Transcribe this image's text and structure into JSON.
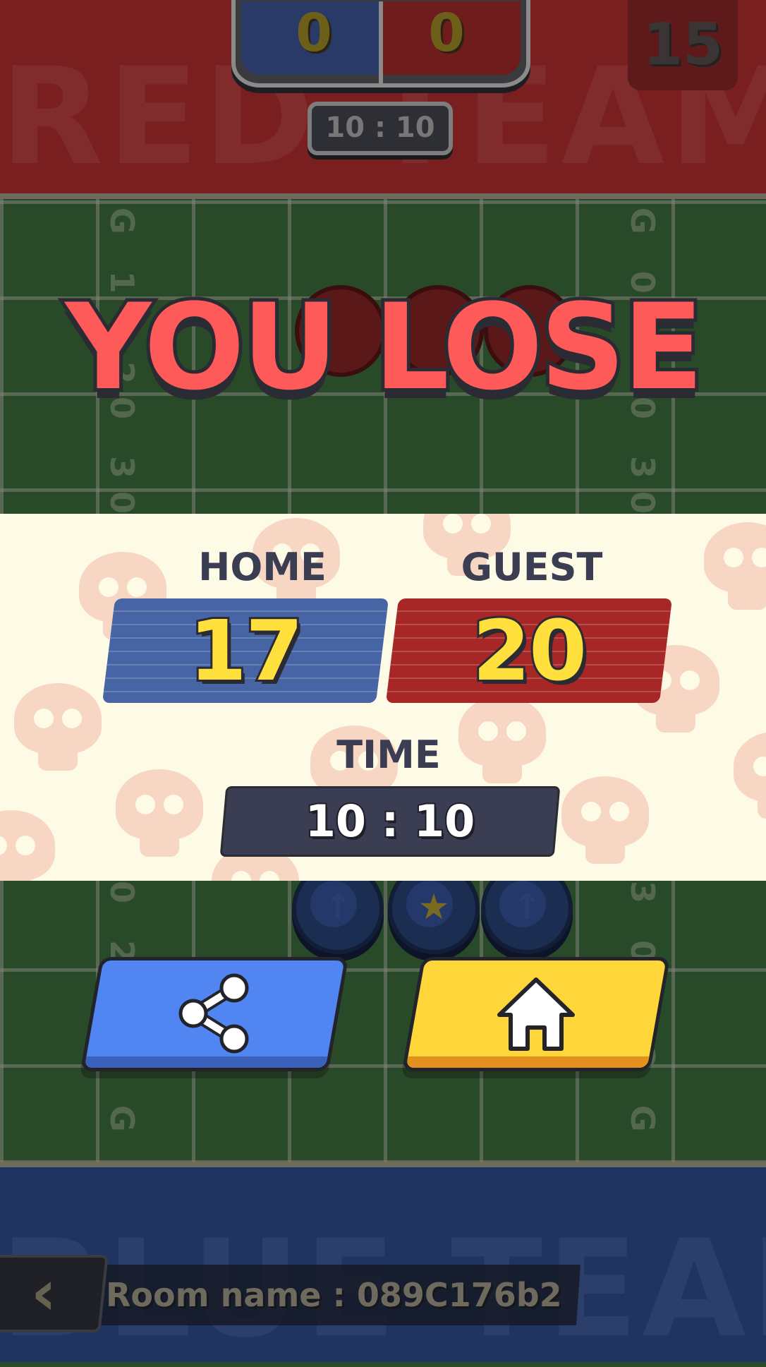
{
  "top_bar": {
    "background_text": "RED TEAM",
    "scoreboard": {
      "blue_score": "0",
      "red_score": "0"
    },
    "match_timer": "10 : 10",
    "round_number": "15"
  },
  "field": {
    "yard_left_top": "G 1",
    "yard_left_mid": "20 30",
    "yard_right_top": "G 0",
    "yard_right_mid": "20 30",
    "yard_left_bottom": "0 2",
    "yard_right_bottom": "3 0",
    "yard_left_end": "0 G",
    "yard_right_end": "2 G"
  },
  "result": {
    "title": "YOU LOSE",
    "home_label": "HOME",
    "home_score": "17",
    "guest_label": "GUEST",
    "guest_score": "20",
    "time_label": "TIME",
    "time_value": "10 : 10"
  },
  "actions": {
    "share_icon": "share-icon",
    "home_icon": "home-icon"
  },
  "bottom_bar": {
    "background_text": "BLUE TEAM",
    "room_name": "Room name : 089C176b2",
    "back_icon": "chevron-left-icon"
  },
  "colors": {
    "red_team": "#7a1f1f",
    "blue_team": "#1f3461",
    "lose_text": "#ff5a5a",
    "home_card": "#4765a4",
    "guest_card": "#a72626",
    "score_yellow": "#ffe03c",
    "share_button": "#5186f2",
    "home_button": "#ffd639"
  }
}
